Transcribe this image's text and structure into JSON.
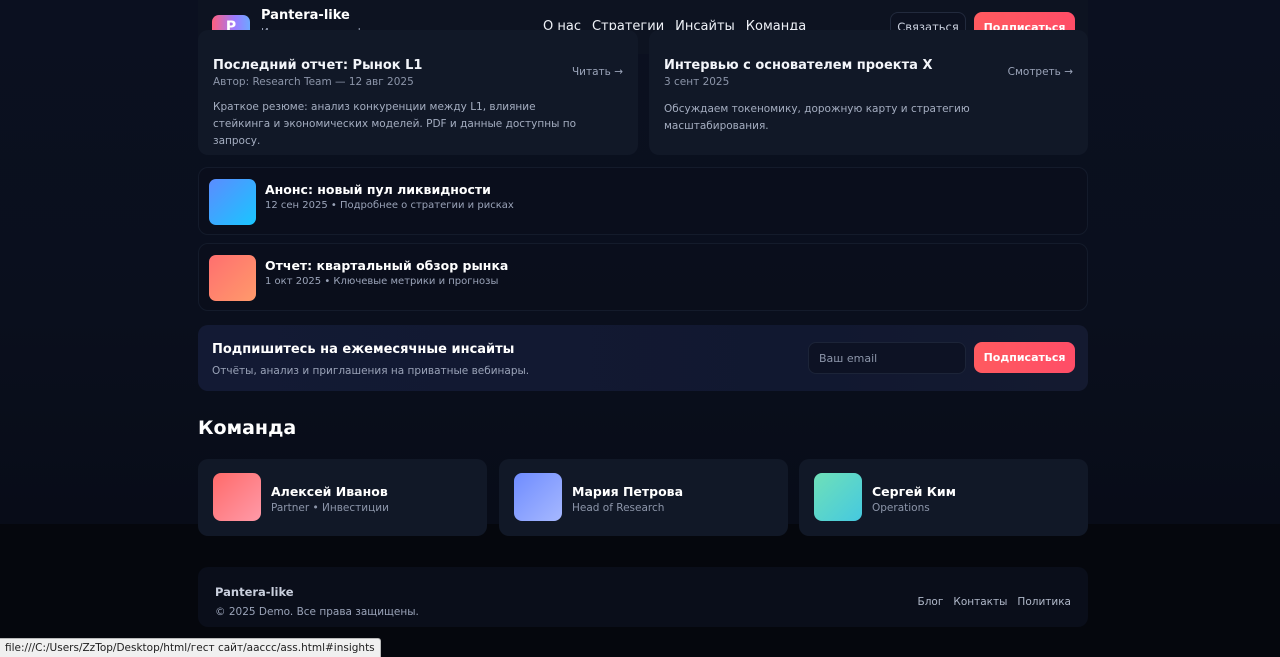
{
  "header": {
    "brand_name": "Pantera-like",
    "brand_sub": "Инвестиции в цифровые активы",
    "logo_letter": "P",
    "nav": [
      "О нас",
      "Стратегии",
      "Инсайты",
      "Команда"
    ],
    "contact_label": "Связаться",
    "subscribe_label": "Подписаться"
  },
  "posts": [
    {
      "title": "Последний отчет: Рынок L1",
      "meta": "Автор: Research Team — 12 авг 2025",
      "link": "Читать →",
      "body": "Краткое резюме: анализ конкуренции между L1, влияние стейкинга и экономических моделей. PDF и данные доступны по запросу."
    },
    {
      "title": "Интервью с основателем проекта X",
      "meta": "3 сент 2025",
      "link": "Смотреть →",
      "body": "Обсуждаем токеномику, дорожную карту и стратегию масштабирования."
    }
  ],
  "items": [
    {
      "title": "Анонс: новый пул ликвидности",
      "meta": "12 сен 2025 • Подробнее о стратегии и рисках"
    },
    {
      "title": "Отчет: квартальный обзор рынка",
      "meta": "1 окт 2025 • Ключевые метрики и прогнозы"
    }
  ],
  "newsletter": {
    "title": "Подпишитесь на ежемесячные инсайты",
    "subtitle": "Отчёты, анализ и приглашения на приватные вебинары.",
    "placeholder": "Ваш email",
    "button": "Подписаться"
  },
  "team": {
    "title": "Команда",
    "members": [
      {
        "name": "Алексей Иванов",
        "role": "Partner • Инвестиции"
      },
      {
        "name": "Мария Петрова",
        "role": "Head of Research"
      },
      {
        "name": "Сергей Ким",
        "role": "Operations"
      }
    ]
  },
  "footer": {
    "brand": "Pantera-like",
    "copyright": "© 2025 Demo. Все права защищены.",
    "links": [
      "Блог",
      "Контакты",
      "Политика"
    ]
  },
  "status_url": "file:///C:/Users/ZzTop/Desktop/html/гест сайт/аассс/ass.html#insights"
}
